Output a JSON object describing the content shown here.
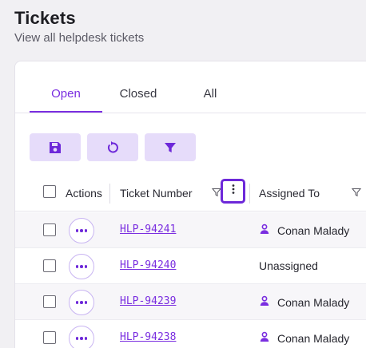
{
  "page": {
    "title": "Tickets",
    "subtitle": "View all helpdesk tickets"
  },
  "tabs": [
    {
      "label": "Open",
      "active": true
    },
    {
      "label": "Closed",
      "active": false
    },
    {
      "label": "All",
      "active": false
    }
  ],
  "toolbar": {
    "buttons": [
      {
        "icon": "save-icon"
      },
      {
        "icon": "refresh-icon"
      },
      {
        "icon": "filter-icon"
      }
    ]
  },
  "table": {
    "columns": {
      "actions": "Actions",
      "ticket_number": "Ticket Number",
      "assigned_to": "Assigned To"
    },
    "rows": [
      {
        "ticket": "HLP-94241",
        "assigned": "Conan Malady",
        "has_user": true
      },
      {
        "ticket": "HLP-94240",
        "assigned": "Unassigned",
        "has_user": false
      },
      {
        "ticket": "HLP-94239",
        "assigned": "Conan Malady",
        "has_user": true
      },
      {
        "ticket": "HLP-94238",
        "assigned": "Conan Malady",
        "has_user": true
      }
    ]
  },
  "colors": {
    "accent": "#7a2ee0",
    "button_bg": "#e6dcfa",
    "focus_border": "#6d28d9"
  }
}
